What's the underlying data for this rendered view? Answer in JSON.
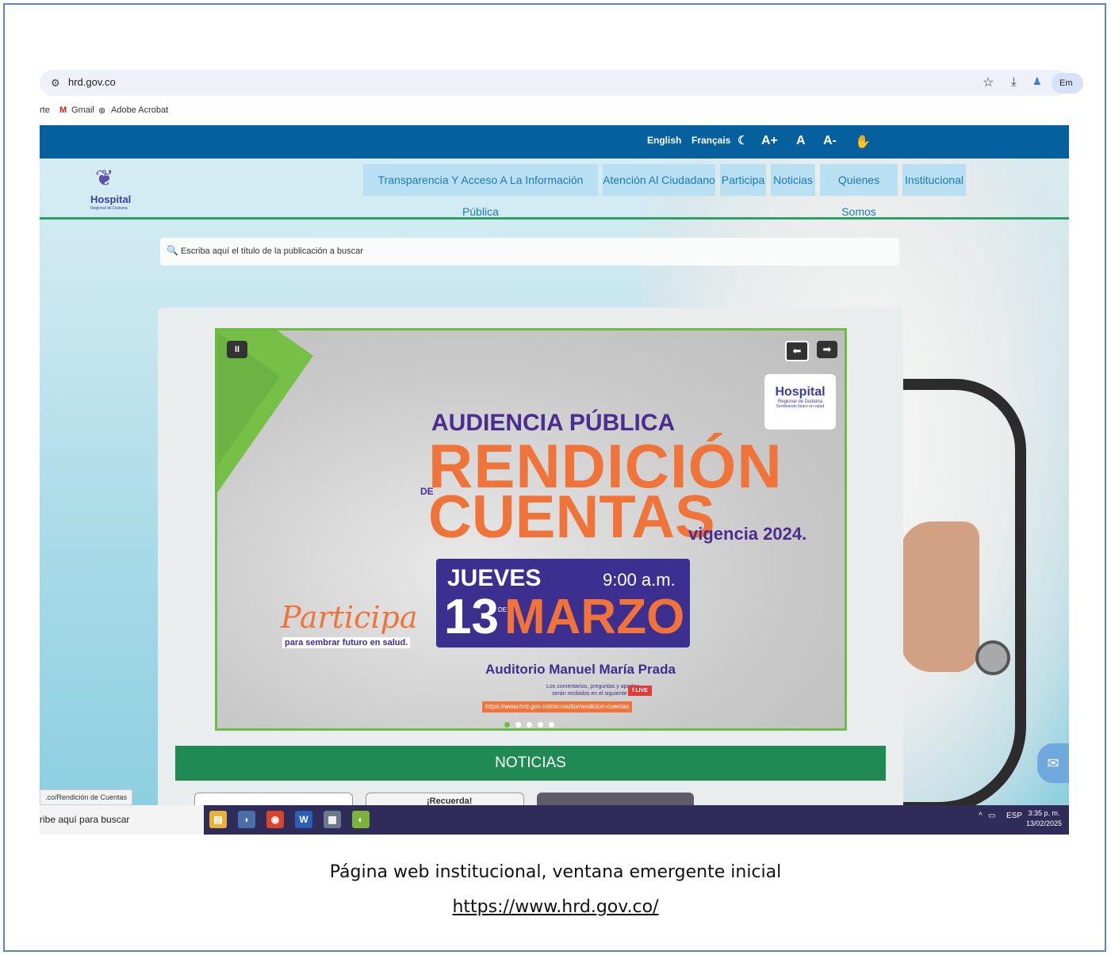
{
  "browser": {
    "url": "hrd.gov.co",
    "profile_label": "Em",
    "bookmarks": [
      "rte",
      "Gmail",
      "Adobe Acrobat"
    ]
  },
  "site": {
    "topbar": {
      "english": "English",
      "francais": "Français",
      "moon": "☾",
      "a_plus": "A+",
      "a": "A",
      "a_minus": "A-",
      "sign": "✋"
    },
    "logo": {
      "name": "Hospital",
      "sub": "Regional de Duitama"
    },
    "nav": [
      "Transparencia Y Acceso A La Información Pública",
      "Atención Al Ciudadano",
      "Participa",
      "Noticias",
      "Quienes Somos",
      "Institucional"
    ],
    "search_placeholder": "Escriba aquí el título de la publicación a buscar",
    "slide": {
      "pause": "II",
      "prev": "⬅",
      "next": "➡",
      "logo_name": "Hospital",
      "logo_sub": "Regional de Duitama",
      "logo_slogan": "Sembrando futuro en salud",
      "audiencia": "AUDIENCIA PÚBLICA",
      "rendicion": "RENDICIÓN",
      "de": "DE",
      "cuentas": "CUENTAS",
      "vigencia": "vigencia 2024.",
      "jueves": "JUEVES",
      "hora": "9:00 a.m.",
      "day": "13",
      "de_small": "DE",
      "month": "MARZO",
      "participa": "Participa",
      "participa_sub": "para sembrar futuro en salud.",
      "auditorio": "Auditorio Manuel María Prada",
      "comentarios1": "Los comentarios, preguntas y aportes",
      "comentarios2": "serán recibidos en el siguiente link",
      "live": "f LIVE",
      "link": "https://www.hrd.gov.co/micrositio/rendicion-cuentas"
    },
    "noticias": "NOTICIAS",
    "recuerda": "¡Recuerda!",
    "status_url": ".co/Rendición de Cuentas",
    "chat_icon": "✉"
  },
  "taskbar": {
    "search": "ribe aquí para buscar",
    "lang": "ESP",
    "time": "3:35 p. m.",
    "date": "13/02/2025"
  },
  "caption": {
    "line1": "Página web institucional, ventana emergente inicial",
    "line2": "https://www.hrd.gov.co/"
  },
  "colors": {
    "topbar": "#06609e",
    "green": "#208a54",
    "orange": "#f0743a",
    "purple": "#3d2f8f",
    "nav_bg": "#b9dff2"
  }
}
